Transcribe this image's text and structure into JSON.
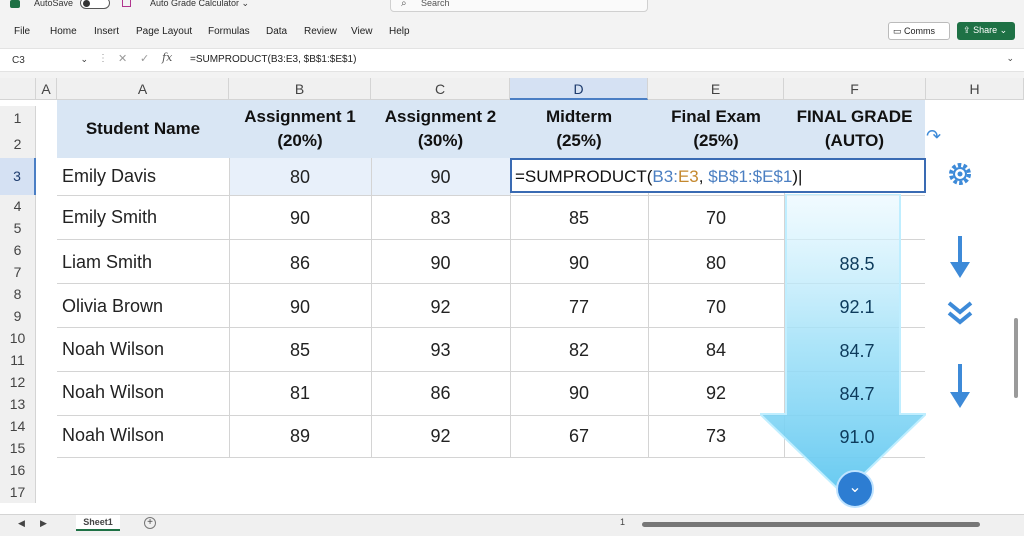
{
  "titlebar": {
    "autosave": "AutoSave",
    "doc_title": "Auto Grade Calculator",
    "search_placeholder": "Search"
  },
  "menu": [
    "File",
    "Home",
    "Insert",
    "Page Layout",
    "Formulas",
    "Data",
    "Review",
    "View",
    "Help"
  ],
  "actions": {
    "comments": "Comms",
    "share": "Share"
  },
  "formula_bar": {
    "name_box": "C3",
    "formula": "=SUMPRODUCT(B3:E3, $B$1:$E$1)"
  },
  "columns": [
    "A",
    "A",
    "B",
    "C",
    "D",
    "E",
    "F",
    "H"
  ],
  "rows": [
    "1",
    "2",
    "3",
    "4",
    "5",
    "6",
    "7",
    "8",
    "9",
    "10",
    "11",
    "12",
    "13",
    "14",
    "15",
    "16",
    "17"
  ],
  "table": {
    "headers": [
      "Student Name",
      "Assignment 1\n(20%)",
      "Assignment 2\n(30%)",
      "Midterm\n(25%)",
      "Final Exam\n(25%)",
      "FINAL GRADE\n(AUTO)"
    ],
    "edit_cell": {
      "prefix": "=SUMPRODUCT(",
      "ref_b": "B3:",
      "ref_e": "E3",
      "sep": ", ",
      "ref_s": "$B$1:$E$1",
      "suffix": ")"
    },
    "data": [
      {
        "name": "Emily Davis",
        "a1": "80",
        "a2": "90",
        "mid": "",
        "final": "",
        "grade": ""
      },
      {
        "name": "Emily Smith",
        "a1": "90",
        "a2": "83",
        "mid": "85",
        "final": "70",
        "grade": ""
      },
      {
        "name": "Liam Smith",
        "a1": "86",
        "a2": "90",
        "mid": "90",
        "final": "80",
        "grade": "88.5"
      },
      {
        "name": "Olivia Brown",
        "a1": "90",
        "a2": "92",
        "mid": "77",
        "final": "70",
        "grade": "92.1"
      },
      {
        "name": "Noah Wilson",
        "a1": "85",
        "a2": "93",
        "mid": "82",
        "final": "84",
        "grade": "84.7"
      },
      {
        "name": "Noah Wilson",
        "a1": "81",
        "a2": "86",
        "mid": "90",
        "final": "92",
        "grade": "84.7"
      },
      {
        "name": "Noah Wilson",
        "a1": "89",
        "a2": "92",
        "mid": "67",
        "final": "73",
        "grade": "91.0"
      }
    ]
  },
  "bottom": {
    "sheet_tab": "Sheet1",
    "add_sheet": "+",
    "page_num": "1"
  },
  "colors": {
    "accent": "#1e7145",
    "header_fill": "#d9e6f4",
    "selection": "#3a6bb3",
    "arrow": "#5fc7f0"
  }
}
